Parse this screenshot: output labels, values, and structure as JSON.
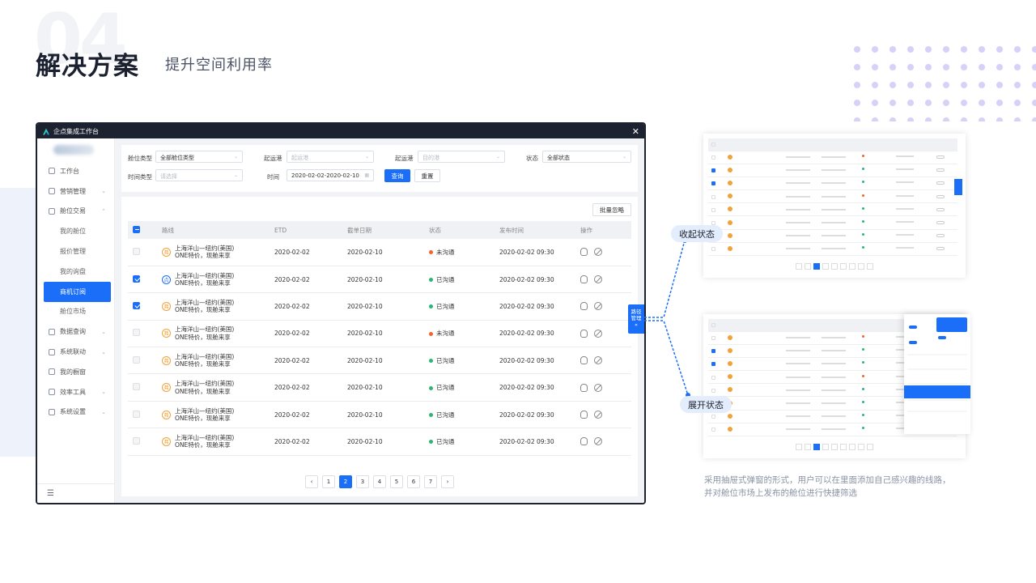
{
  "slide": {
    "bignum": "04",
    "title": "解决方案",
    "subtitle": "提升空间利用率",
    "state_collapsed": "收起状态",
    "state_expanded": "展开状态",
    "description": "采用抽屉式弹窗的形式，用户可以在里面添加自己感兴趣的线路，并对舱位市场上发布的舱位进行快捷筛选"
  },
  "window": {
    "title": "企点集成工作台",
    "close": "✕"
  },
  "sidebar": {
    "items": [
      {
        "label": "工作台"
      },
      {
        "label": "营销管理",
        "chevron": "⌄"
      },
      {
        "label": "舱位交易",
        "chevron": "⌃"
      },
      {
        "label": "我的舱位",
        "sub": true
      },
      {
        "label": "报价管理",
        "sub": true
      },
      {
        "label": "我的询盘",
        "sub": true
      },
      {
        "label": "商机订阅",
        "sub": true,
        "active": true
      },
      {
        "label": "舱位市场",
        "sub": true
      },
      {
        "label": "数据查询",
        "chevron": "⌄"
      },
      {
        "label": "系统联动",
        "chevron": "⌄"
      },
      {
        "label": "我的橱窗"
      },
      {
        "label": "效率工具",
        "chevron": "⌄"
      },
      {
        "label": "系统设置",
        "chevron": "⌄"
      }
    ],
    "collapse_icon": "☰"
  },
  "filter": {
    "cabin_type_label": "舱位类型",
    "cabin_type_value": "全部舱位类型",
    "origin_label": "起运港",
    "origin_placeholder": "起运港",
    "dest_label": "起运港",
    "dest_placeholder": "目的港",
    "status_label": "状态",
    "status_value": "全部状态",
    "time_type_label": "时间类型",
    "time_type_placeholder": "请选择",
    "time_label": "时间",
    "time_value": "2020-02-02-2020-02-10",
    "query_button": "查询",
    "reset_button": "重置"
  },
  "table": {
    "bulk_button": "批量忽略",
    "columns": [
      "路线",
      "ETD",
      "截单日期",
      "状态",
      "发布时间",
      "操作"
    ],
    "rows": [
      {
        "checked": false,
        "badge": "弗",
        "route1": "上海洋山—纽约(美国)",
        "route2": "ONE特价，现舱来享",
        "etd": "2020-02-02",
        "cutoff": "2020-02-10",
        "status": "未沟通",
        "status_color": "#f5642d",
        "pub": "2020-02-02 09:30"
      },
      {
        "checked": true,
        "badge": "点",
        "badge_blue": true,
        "route1": "上海洋山—纽约(美国)",
        "route2": "ONE特价，现舱来享",
        "etd": "2020-02-02",
        "cutoff": "2020-02-10",
        "status": "已沟通",
        "status_color": "#2bb673",
        "pub": "2020-02-02 09:30"
      },
      {
        "checked": true,
        "badge": "弗",
        "route1": "上海洋山—纽约(美国)",
        "route2": "ONE特价，现舱来享",
        "etd": "2020-02-02",
        "cutoff": "2020-02-10",
        "status": "已沟通",
        "status_color": "#2bb673",
        "pub": "2020-02-02 09:30"
      },
      {
        "checked": false,
        "badge": "弗",
        "route1": "上海洋山—纽约(美国)",
        "route2": "ONE特价，现舱来享",
        "etd": "2020-02-02",
        "cutoff": "2020-02-10",
        "status": "未沟通",
        "status_color": "#f5642d",
        "pub": "2020-02-02 09:30"
      },
      {
        "checked": false,
        "badge": "弗",
        "route1": "上海洋山—纽约(美国)",
        "route2": "ONE特价，现舱来享",
        "etd": "2020-02-02",
        "cutoff": "2020-02-10",
        "status": "已沟通",
        "status_color": "#2bb673",
        "pub": "2020-02-02 09:30"
      },
      {
        "checked": false,
        "badge": "弗",
        "route1": "上海洋山—纽约(美国)",
        "route2": "ONE特价，现舱来享",
        "etd": "2020-02-02",
        "cutoff": "2020-02-10",
        "status": "已沟通",
        "status_color": "#2bb673",
        "pub": "2020-02-02 09:30"
      },
      {
        "checked": false,
        "badge": "弗",
        "route1": "上海洋山—纽约(美国)",
        "route2": "ONE特价，现舱来享",
        "etd": "2020-02-02",
        "cutoff": "2020-02-10",
        "status": "已沟通",
        "status_color": "#2bb673",
        "pub": "2020-02-02 09:30"
      },
      {
        "checked": false,
        "badge": "弗",
        "route1": "上海洋山—纽约(美国)",
        "route2": "ONE特价，现舱来享",
        "etd": "2020-02-02",
        "cutoff": "2020-02-10",
        "status": "已沟通",
        "status_color": "#2bb673",
        "pub": "2020-02-02 09:30"
      }
    ]
  },
  "pagination": {
    "prev": "‹",
    "next": "›",
    "pages": [
      "1",
      "2",
      "3",
      "4",
      "5",
      "6",
      "7"
    ],
    "current": "2"
  },
  "drawer_tab": {
    "line1": "路径",
    "line2": "管理",
    "arrow": "«"
  },
  "colors": {
    "accent": "#1a6ef7",
    "dark": "#1d2230",
    "pending": "#f5642d",
    "done": "#2bb673"
  }
}
